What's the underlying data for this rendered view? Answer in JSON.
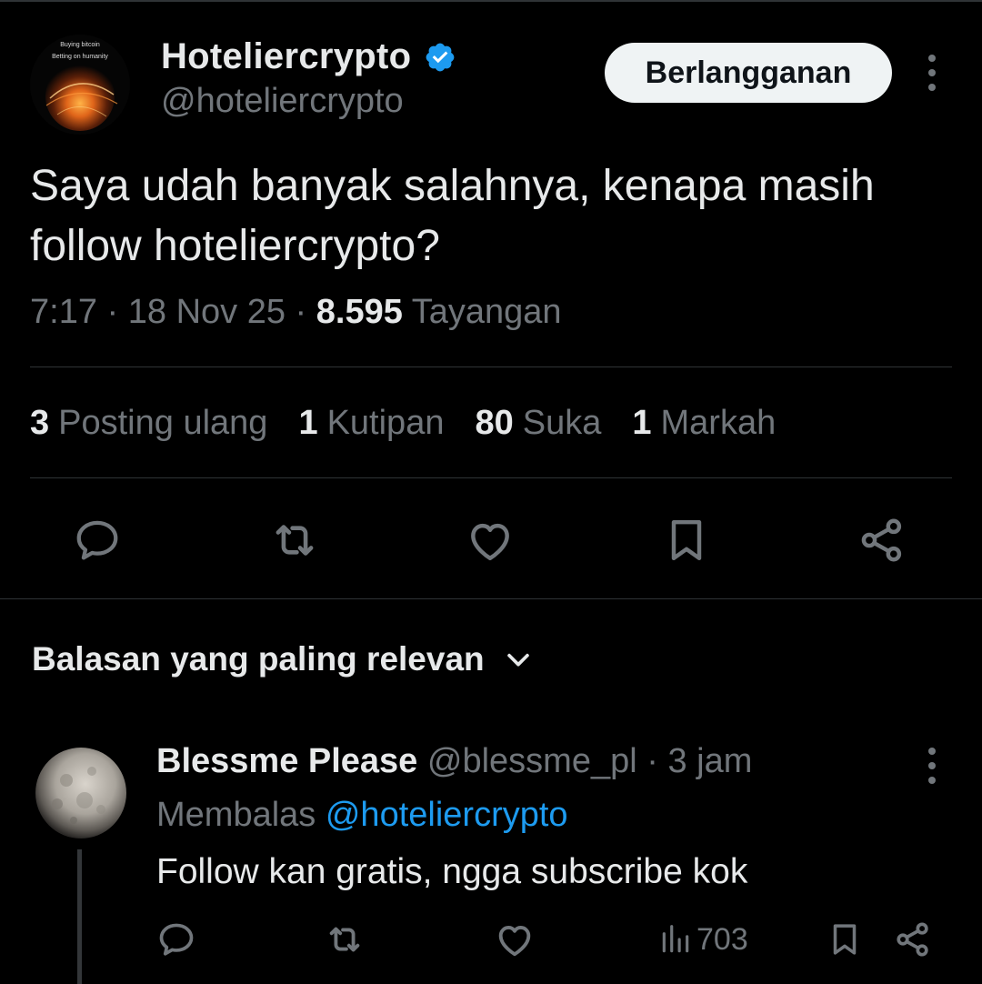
{
  "tweet": {
    "author": {
      "display_name": "Hoteliercrypto",
      "handle": "@hoteliercrypto",
      "verified": true,
      "avatar_text_line1": "Buying bitcoin",
      "avatar_text_line2": "Betting on humanity"
    },
    "subscribe_label": "Berlangganan",
    "text": "Saya udah banyak salahnya, kenapa masih follow hoteliercrypto?",
    "time": "7:17",
    "date": "18 Nov 25",
    "separator": "·",
    "views_count": "8.595",
    "views_label": "Tayangan",
    "stats": [
      {
        "count": "3",
        "label": "Posting ulang"
      },
      {
        "count": "1",
        "label": "Kutipan"
      },
      {
        "count": "80",
        "label": "Suka"
      },
      {
        "count": "1",
        "label": "Markah"
      }
    ],
    "actions": [
      "reply-icon",
      "repost-icon",
      "like-icon",
      "bookmark-icon",
      "share-icon"
    ]
  },
  "replies_section": {
    "sort_label": "Balasan yang paling relevan"
  },
  "reply": {
    "display_name": "Blessme Please",
    "handle": "@blessme_pl",
    "separator": "·",
    "time_ago": "3 jam",
    "replying_label": "Membalas",
    "replying_to": "@hoteliercrypto",
    "text": "Follow kan gratis, ngga subscribe kok",
    "views_count": "703"
  },
  "colors": {
    "background": "#000000",
    "primary_text": "#e7e9ea",
    "secondary_text": "#71767b",
    "accent_blue": "#1d9bf0",
    "divider": "#2f3336"
  }
}
